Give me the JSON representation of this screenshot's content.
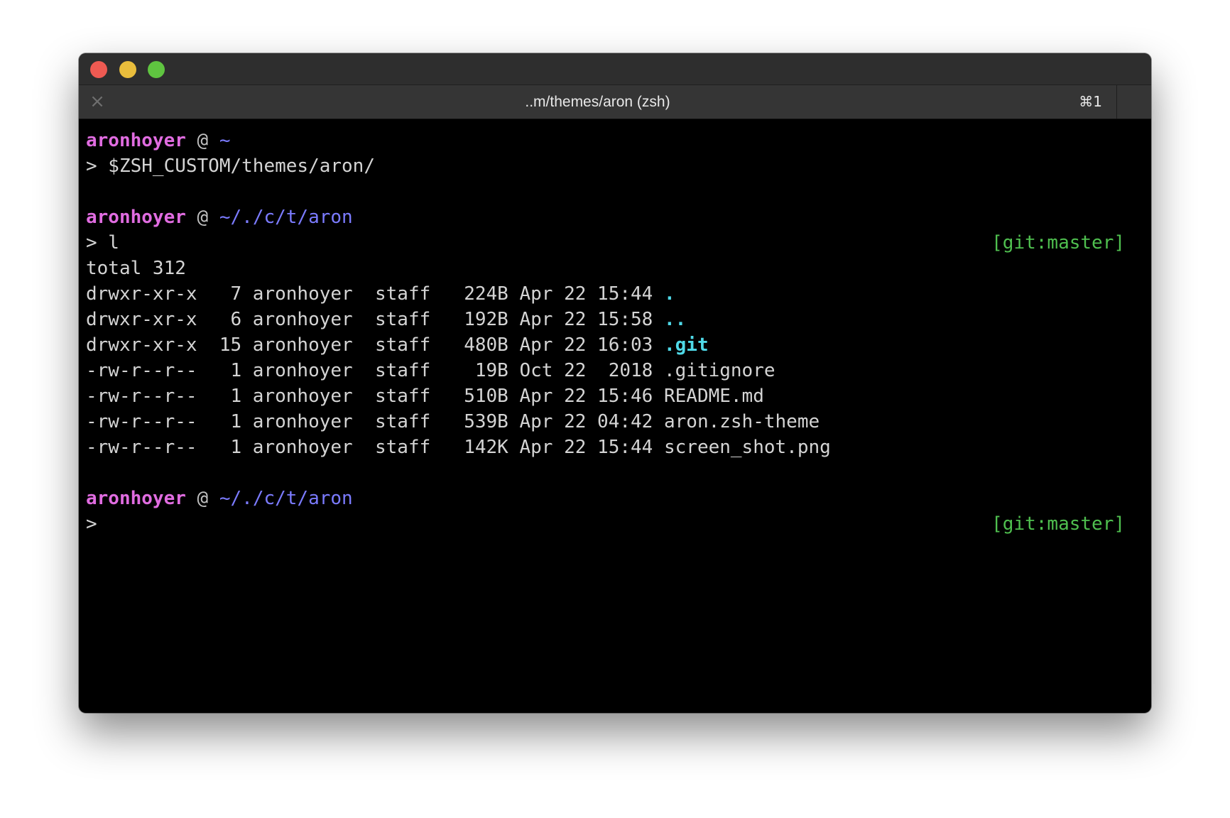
{
  "window": {
    "title": "..m/themes/aron (zsh)",
    "shortcut": "⌘1",
    "close_icon": "×",
    "colors": {
      "close": "#ee5a52",
      "minimize": "#e9bd3c",
      "zoom": "#5fc440"
    }
  },
  "prompt_user": "aronhoyer",
  "prompt_at": "@",
  "blocks": {
    "b1": {
      "path": "~",
      "command": "> $ZSH_CUSTOM/themes/aron/"
    },
    "b2": {
      "path": "~/./c/t/aron",
      "command": "> l",
      "git": "[git:master]"
    },
    "b3": {
      "path": "~/./c/t/aron",
      "command": ">",
      "git": "[git:master]"
    }
  },
  "listing": {
    "total": "total 312",
    "rows": [
      {
        "meta": "drwxr-xr-x   7 aronhoyer  staff   224B Apr 22 15:44 ",
        "name": ".",
        "is_dir": true
      },
      {
        "meta": "drwxr-xr-x   6 aronhoyer  staff   192B Apr 22 15:58 ",
        "name": "..",
        "is_dir": true
      },
      {
        "meta": "drwxr-xr-x  15 aronhoyer  staff   480B Apr 22 16:03 ",
        "name": ".git",
        "is_dir": true
      },
      {
        "meta": "-rw-r--r--   1 aronhoyer  staff    19B Oct 22  2018 ",
        "name": ".gitignore",
        "is_dir": false
      },
      {
        "meta": "-rw-r--r--   1 aronhoyer  staff   510B Apr 22 15:46 ",
        "name": "README.md",
        "is_dir": false
      },
      {
        "meta": "-rw-r--r--   1 aronhoyer  staff   539B Apr 22 04:42 ",
        "name": "aron.zsh-theme",
        "is_dir": false
      },
      {
        "meta": "-rw-r--r--   1 aronhoyer  staff   142K Apr 22 15:44 ",
        "name": "screen_shot.png",
        "is_dir": false
      }
    ]
  },
  "theme_colors": {
    "user": "#e06ce0",
    "path": "#7b7bff",
    "git": "#4fbf4f",
    "directory": "#4fd9e8",
    "text": "#d4d4d4",
    "background": "#000000"
  }
}
